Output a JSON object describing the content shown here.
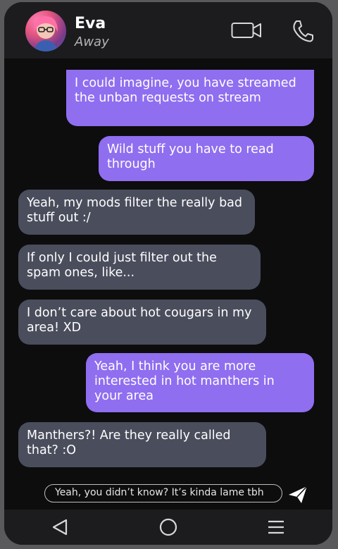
{
  "contact": {
    "name": "Eva",
    "status": "Away"
  },
  "header": {
    "video_icon": "video-camera-icon",
    "call_icon": "phone-icon"
  },
  "messages": [
    {
      "dir": "out",
      "text": "I could imagine, you have streamed the unban requests on stream"
    },
    {
      "dir": "out",
      "text": "Wild stuff you have to read through"
    },
    {
      "dir": "in",
      "text": "Yeah, my mods filter the really bad stuff out :/"
    },
    {
      "dir": "in",
      "text": "If only I could just filter out the spam ones, like..."
    },
    {
      "dir": "in",
      "text": "I don’t care about hot cougars in my area! XD"
    },
    {
      "dir": "out",
      "text": "Yeah, I think you are more interested in hot manthers in your area"
    },
    {
      "dir": "in",
      "text": "Manthers?! Are they really called that? :O"
    }
  ],
  "composer": {
    "value": "Yeah, you didn’t know? It’s kinda lame tbh",
    "send_icon": "send-icon"
  },
  "navbar": {
    "back_icon": "back-triangle-icon",
    "home_icon": "home-circle-icon",
    "menu_icon": "menu-lines-icon"
  },
  "colors": {
    "outgoing": "#8f6ef0",
    "incoming": "#4a4d5c",
    "background": "#0d0d0e",
    "frame": "#1c1c1e"
  }
}
